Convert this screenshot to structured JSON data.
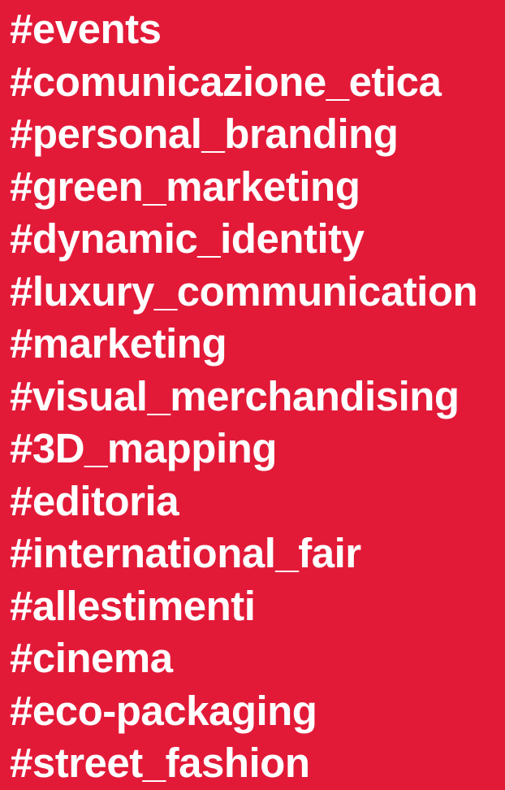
{
  "background_color": "#e21a38",
  "text_color": "#ffffff",
  "tags": [
    "#events",
    "#comunicazione_etica",
    "#personal_branding",
    "#green_marketing",
    "#dynamic_identity",
    "#luxury_communication",
    "#marketing",
    "#visual_merchandising",
    "#3D_mapping",
    "#editoria",
    "#international_fair",
    "#allestimenti",
    "#cinema",
    "#eco-packaging",
    "#street_fashion"
  ]
}
